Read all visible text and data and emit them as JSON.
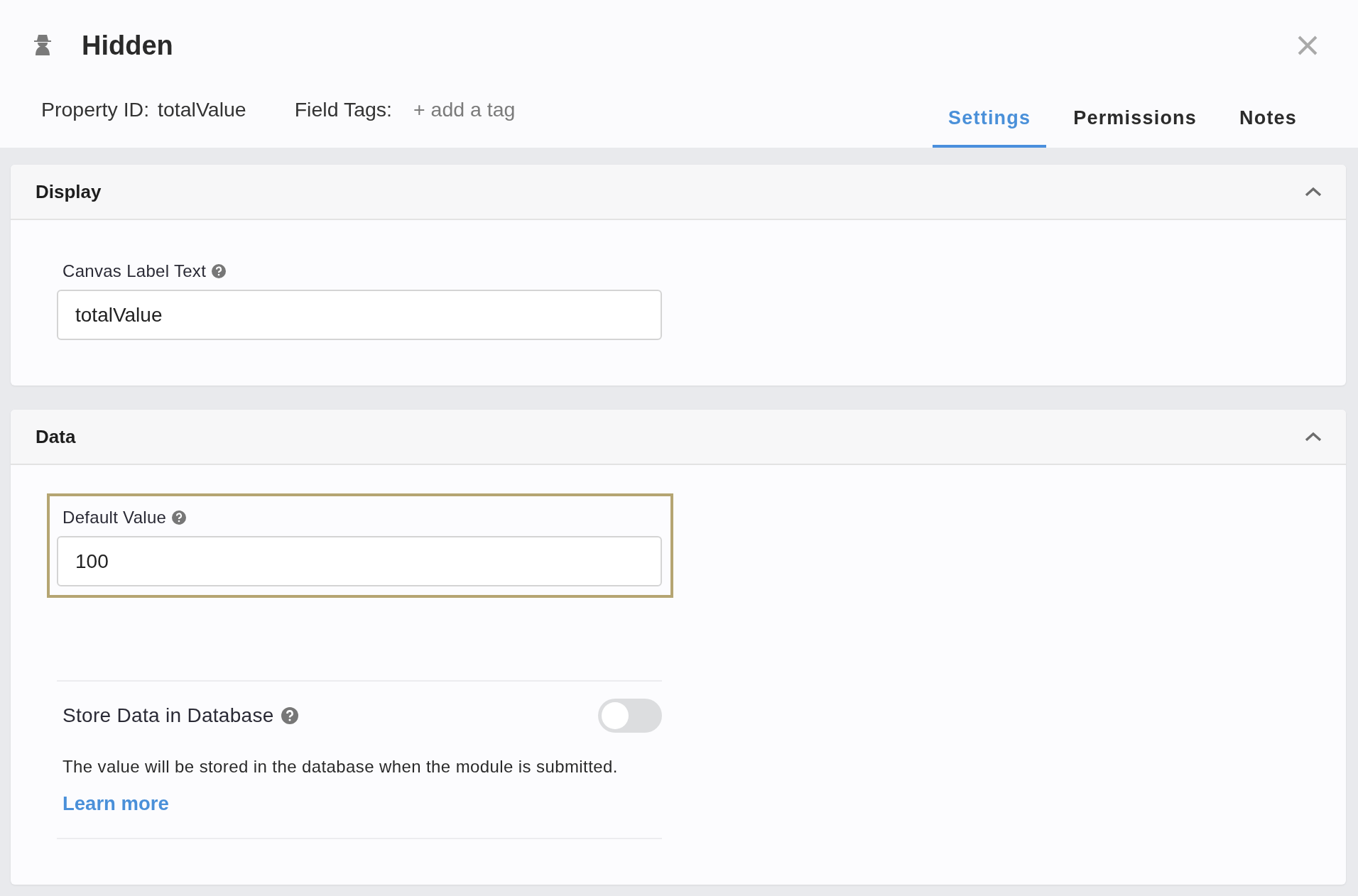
{
  "dialog": {
    "title": "Hidden",
    "property_id_label": "Property ID:",
    "property_id": "totalValue",
    "field_tags_label": "Field Tags:",
    "field_tags_placeholder": "+ add a tag"
  },
  "tabs": [
    {
      "label": "Settings",
      "selected": true
    },
    {
      "label": "Permissions",
      "selected": false
    },
    {
      "label": "Notes",
      "selected": false
    }
  ],
  "sections": [
    {
      "title": "Display",
      "expanded": true,
      "items": [
        {
          "kind": "input",
          "label": "Canvas Label Text",
          "value": "totalValue",
          "highlighted": false
        }
      ]
    },
    {
      "title": "Data",
      "expanded": true,
      "items": [
        {
          "kind": "input",
          "label": "Default Value",
          "value": "100",
          "highlighted": true
        },
        {
          "kind": "toggle",
          "label": "Store Data in Database",
          "on": false,
          "description": "The value will be stored in the database when the module is submitted.",
          "link": "Learn more"
        }
      ]
    }
  ]
}
